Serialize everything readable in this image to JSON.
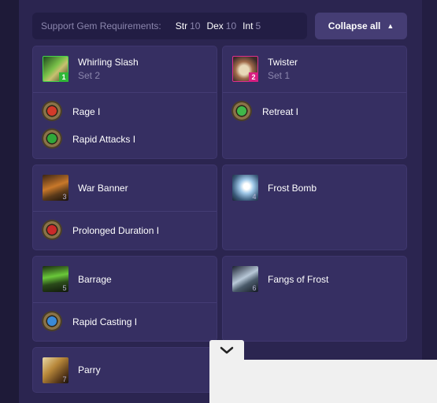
{
  "requirements": {
    "label": "Support Gem Requirements:",
    "str_key": "Str",
    "str_val": "10",
    "dex_key": "Dex",
    "dex_val": "10",
    "int_key": "Int",
    "int_val": "5"
  },
  "collapse_button": {
    "label": "Collapse all"
  },
  "cards": [
    {
      "name": "Whirling Slash",
      "set": "Set 2",
      "badge": "1",
      "supports": [
        "Rage I",
        "Rapid Attacks I"
      ]
    },
    {
      "name": "Twister",
      "set": "Set 1",
      "badge": "2",
      "supports": [
        "Retreat I"
      ]
    },
    {
      "name": "War Banner",
      "badge": "3",
      "supports": [
        "Prolonged Duration I"
      ]
    },
    {
      "name": "Frost Bomb",
      "badge": "4",
      "supports": []
    },
    {
      "name": "Barrage",
      "badge": "5",
      "supports": [
        "Rapid Casting I"
      ]
    },
    {
      "name": "Fangs of Frost",
      "badge": "6",
      "supports": []
    },
    {
      "name": "Parry",
      "badge": "7",
      "supports": []
    }
  ],
  "colors": {
    "panel": "#2b2550",
    "card": "#362f62",
    "accent_green": "#2fb837",
    "accent_pink": "#d81f82"
  },
  "icons": {
    "collapse_caret": "caret-up-icon",
    "expand_chevron": "chevron-down-icon"
  }
}
